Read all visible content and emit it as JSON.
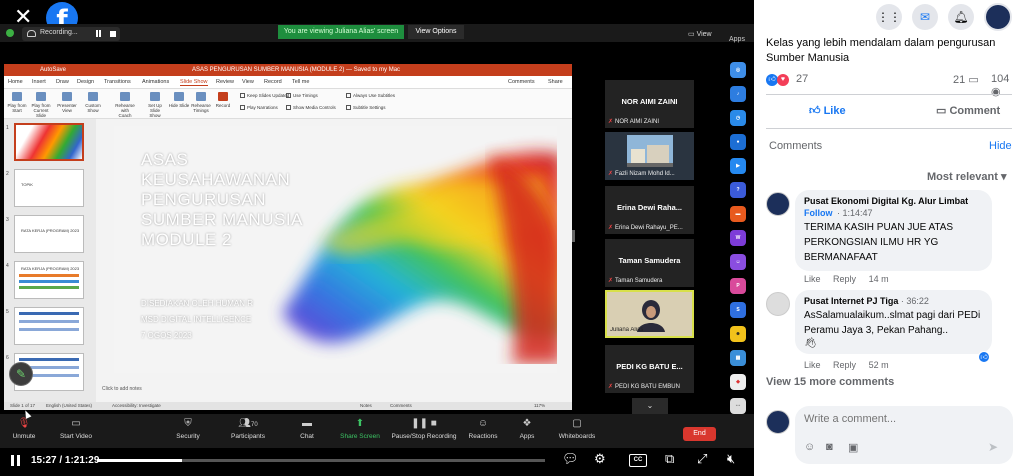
{
  "zoom": {
    "recording_label": "Recording...",
    "viewing_banner": "You are viewing Juliana Alias' screen",
    "view_options": "View Options",
    "view_label": "View",
    "apps_label": "Apps",
    "end_label": "End",
    "toolbar": [
      {
        "label": "Unmute",
        "icon": "mic-muted-icon"
      },
      {
        "label": "Start Video",
        "icon": "video-off-icon"
      },
      {
        "label": "Security",
        "icon": "shield-icon"
      },
      {
        "label": "Participants",
        "icon": "people-icon",
        "count": "70"
      },
      {
        "label": "Chat",
        "icon": "chat-icon"
      },
      {
        "label": "Share Screen",
        "icon": "share-screen-icon"
      },
      {
        "label": "Pause/Stop Recording",
        "icon": "recording-icon"
      },
      {
        "label": "Reactions",
        "icon": "reaction-icon"
      },
      {
        "label": "Apps",
        "icon": "apps-icon"
      },
      {
        "label": "Whiteboards",
        "icon": "whiteboard-icon"
      }
    ],
    "participants": [
      {
        "name": "NOR AIMI ZAINI",
        "label": "NOR AIMI ZAINI"
      },
      {
        "name": "",
        "label": "Fazli Nizam Mohd Id..."
      },
      {
        "name": "Erina Dewi Raha...",
        "label": "Erina Dewi Rahayu_PE..."
      },
      {
        "name": "Taman Samudera",
        "label": "Taman Samudera"
      },
      {
        "name": "",
        "label": "Juliana Alias"
      },
      {
        "name": "PEDI KG BATU E...",
        "label": "PEDI KG BATU EMBUN"
      }
    ]
  },
  "powerpoint": {
    "autosave": "AutoSave",
    "title": "ASAS PENGURUSAN SUMBER MANUSIA (MODULE 2) — Saved to my Mac",
    "tabs": [
      "Home",
      "Insert",
      "Draw",
      "Design",
      "Transitions",
      "Animations",
      "Slide Show",
      "Review",
      "View",
      "Record",
      "Tell me"
    ],
    "active_tab": "Slide Show",
    "comments": "Comments",
    "share": "Share",
    "ribbon": [
      "Play from Start",
      "Play from Current Slide",
      "Presenter View",
      "Custom Show",
      "Rehearse with Coach",
      "Set Up Slide Show",
      "Hide Slide",
      "Rehearse Timings",
      "Record"
    ],
    "options": [
      "Keep Slides Updated",
      "Use Timings",
      "Play Narrations",
      "Show Media Controls",
      "Always Use Subtitles",
      "Subtitle Settings"
    ],
    "thumb_texts": [
      "",
      "TOPIK",
      "RATA KERJA (PROGRAM) 2023",
      "RATA KERJA (PROGRAM) 2023",
      "",
      ""
    ],
    "slide_title": [
      "ASAS",
      "KEUSAHAWANAN",
      "PENGURUSAN",
      "SUMBER MANUSIA",
      "MODULE 2"
    ],
    "slide_sub": [
      "DISEDIAKAN OLEH HUMAN R",
      "MSD DIGITAL INTELLIGENCE",
      "7 OGOS 2023"
    ],
    "notes_placeholder": "Click to add notes",
    "status_slide": "Slide 1 of 17",
    "status_lang": "English (United States)",
    "status_access": "Accessibility: Investigate",
    "status_notes": "Notes",
    "status_comments": "Comments",
    "status_zoom": "117%"
  },
  "player": {
    "time": "15:27 / 1:21:29",
    "progress": 0.19,
    "cc": "CC"
  },
  "facebook": {
    "post_text": "Kelas yang lebih mendalam dalam pengurusan Sumber Manusia",
    "reactions_count": "27",
    "comments_count": "21",
    "shares_count": "104",
    "like_label": "Like",
    "comment_label": "Comment",
    "comments_header": "Comments",
    "hide_label": "Hide",
    "sort_label": "Most relevant",
    "comments": [
      {
        "name": "Pusat Ekonomi Digital Kg. Alur Limbat",
        "follow": "Follow",
        "time": "1:14:47",
        "text": "TERIMA KASIH PUAN JUE ATAS PERKONGSIAN ILMU HR YG BERMANAFAAT",
        "like": "Like",
        "reply": "Reply",
        "age": "14 m"
      },
      {
        "name": "Pusat Internet PJ Tiga",
        "follow": "",
        "time": "36:22",
        "text": "AsSalamualaikum..slmat pagi dari PEDi Peramu Jaya 3, Pekan Pahang..",
        "like": "Like",
        "reply": "Reply",
        "age": "52 m"
      }
    ],
    "view_more": "View 15 more comments",
    "write_placeholder": "Write a comment..."
  }
}
